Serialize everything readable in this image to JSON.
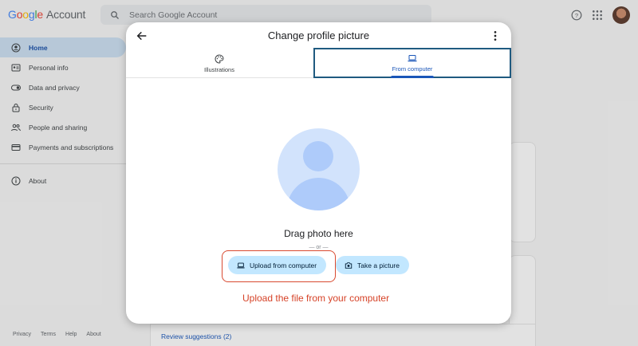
{
  "header": {
    "logo_word": "Google",
    "logo_suffix": "Account",
    "search_placeholder": "Search Google Account"
  },
  "sidebar": {
    "items": [
      {
        "label": "Home",
        "icon": "home-person-icon",
        "active": true
      },
      {
        "label": "Personal info",
        "icon": "id-card-icon"
      },
      {
        "label": "Data and privacy",
        "icon": "toggle-icon"
      },
      {
        "label": "Security",
        "icon": "lock-icon"
      },
      {
        "label": "People and sharing",
        "icon": "people-icon"
      },
      {
        "label": "Payments and subscriptions",
        "icon": "card-icon"
      }
    ],
    "about": "About"
  },
  "footer": {
    "links": [
      "Privacy",
      "Terms",
      "Help",
      "About"
    ]
  },
  "background": {
    "review_link": "Review suggestions (2)"
  },
  "modal": {
    "title": "Change profile picture",
    "tabs": [
      {
        "label": "Illustrations",
        "icon": "palette-icon"
      },
      {
        "label": "From computer",
        "icon": "laptop-icon",
        "selected": true
      }
    ],
    "drag_text": "Drag photo here",
    "or_text": "— or —",
    "upload_button": "Upload from computer",
    "take_picture_button": "Take a picture"
  },
  "annotation": {
    "text": "Upload the file from your computer",
    "color": "#d64227"
  },
  "colors": {
    "accent": "#1a56b8",
    "pill": "#c2e7ff",
    "active_nav": "#c9dcee"
  }
}
